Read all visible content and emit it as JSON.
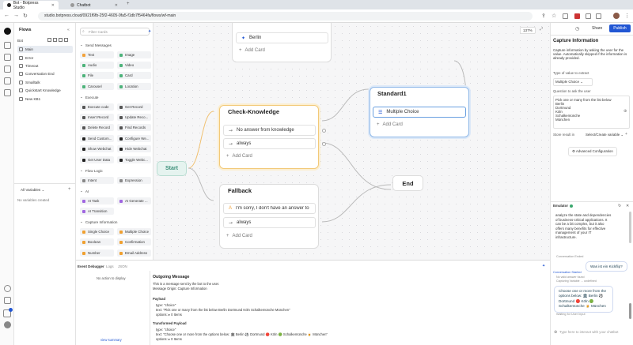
{
  "browser": {
    "tabs": [
      {
        "title": "Bot - Botpress Studio",
        "active": true
      },
      {
        "title": "Chatbot",
        "active": false
      }
    ],
    "url": "studio.botpress.cloud/0921f6fb-25f2-4605-9fa5-f1db7f5464fa/flows/wf-main"
  },
  "flows_panel": {
    "title": "Flows",
    "bot_label": "Bot",
    "items": [
      "Main",
      "Error",
      "Timeout",
      "Conversation End",
      "Smalltalk",
      "Quickstart Knowledge",
      "New KB1"
    ],
    "selected": "Main",
    "variables_select": "All Variables",
    "variables_empty": "No variables created"
  },
  "cards_panel": {
    "filter_placeholder": "Filter Cards",
    "sections": [
      {
        "title": "Send Messages",
        "items": [
          "Text",
          "Image",
          "Audio",
          "Video",
          "File",
          "Card",
          "Carousel",
          "Location"
        ]
      },
      {
        "title": "Execute",
        "items": [
          "Execute code",
          "Get Record",
          "Insert Record",
          "Update Reco...",
          "Delete Record",
          "Find Records",
          "Send Custom...",
          "Configure We...",
          "Show Webchat",
          "Hide Webchat",
          "Get User Data",
          "Toggle Webc..."
        ]
      },
      {
        "title": "Flow Logic",
        "items": [
          "Intent",
          "Expression"
        ]
      },
      {
        "title": "AI",
        "items": [
          "AI Task",
          "AI Generate ...",
          "AI Transition"
        ]
      },
      {
        "title": "Capture Information",
        "items": [
          "Single Choice",
          "Multiple Choice",
          "Boolean",
          "Confirmation",
          "Number",
          "Email Address"
        ]
      }
    ]
  },
  "canvas": {
    "zoom": "137%",
    "top_node": {
      "row": "Berlin",
      "add": "Add Card"
    },
    "check_knowledge": {
      "title": "Check-Knowledge",
      "rows": [
        "No answer from knowledge",
        "always"
      ],
      "add": "Add Card"
    },
    "standard1": {
      "title": "Standard1",
      "rows": [
        "Multiple Choice"
      ],
      "add": "Add Card"
    },
    "fallback": {
      "title": "Fallback",
      "rows": [
        "I'm sorry, I don't have an answer to ...",
        "always"
      ],
      "add": "Add Card"
    },
    "start": "Start",
    "end": "End"
  },
  "debugger": {
    "tabs": [
      "Event Debugger",
      "Logs",
      "JSON"
    ],
    "no_action": "No action to display",
    "view_summary": "view summary",
    "outgoing_title": "Outgoing Message",
    "outgoing_desc": "This is a message sent by the bot to the user.",
    "origin": "Message Origin: Capture Information",
    "payload_title": "Payload",
    "payload_lines": [
      "type: \"choice\"",
      "text: \"Pick one or many from the list below Berlin Dortmund Köln Schalkemünche München\"",
      "options: ▸ 0 Items"
    ],
    "transformed_title": "Transformed Payload",
    "transformed_lines": [
      "type: \"choice\"",
      "text: \"Choose one or more from the options below: 🏛 Berlin ⚽ Dortmund 🔴 Köln 🟢 Schalkemünche 🍺 München\"",
      "options: ▸ 0 Items"
    ]
  },
  "header": {
    "share": "Share",
    "publish": "Publish"
  },
  "inspector": {
    "title": "Capture Information",
    "desc": "Capture information by asking the user for the value. Automatically skipped if the information is already provided.",
    "type_label": "Type of value to extract",
    "type_value": "Multiple Choice",
    "question_label": "Question to ask the user",
    "question_lines": [
      "Pick one or many from the list below",
      "Berlin",
      "Dortmund",
      "Köln",
      "Schalkemünche",
      "München"
    ],
    "store_label": "Store result in",
    "store_value": "Select/Create variable",
    "advanced": "Advanced Configuration"
  },
  "emulator": {
    "title": "Emulator",
    "bot_text": "analyze the state and dependencies of business-critical applications. It can be a bit complex, but it also offers many benefits for effective management of your IT infrastructure.",
    "conversation_ended": "Conversation Ended",
    "user_msg": "Was ist ein Kickflip?",
    "started": "Conversation Started",
    "no_answer": "No valid answer found",
    "capture": "Capturing Variable → undefined",
    "choice_msg": "Choose one or more from the options below: 🏛 Berlin ⚽ Dortmund 🔴 Köln 🟢 Schalkemünche 🍺 München",
    "waiting": "Waiting for User Input",
    "input_placeholder": "Type here to interact with your chatbot"
  }
}
